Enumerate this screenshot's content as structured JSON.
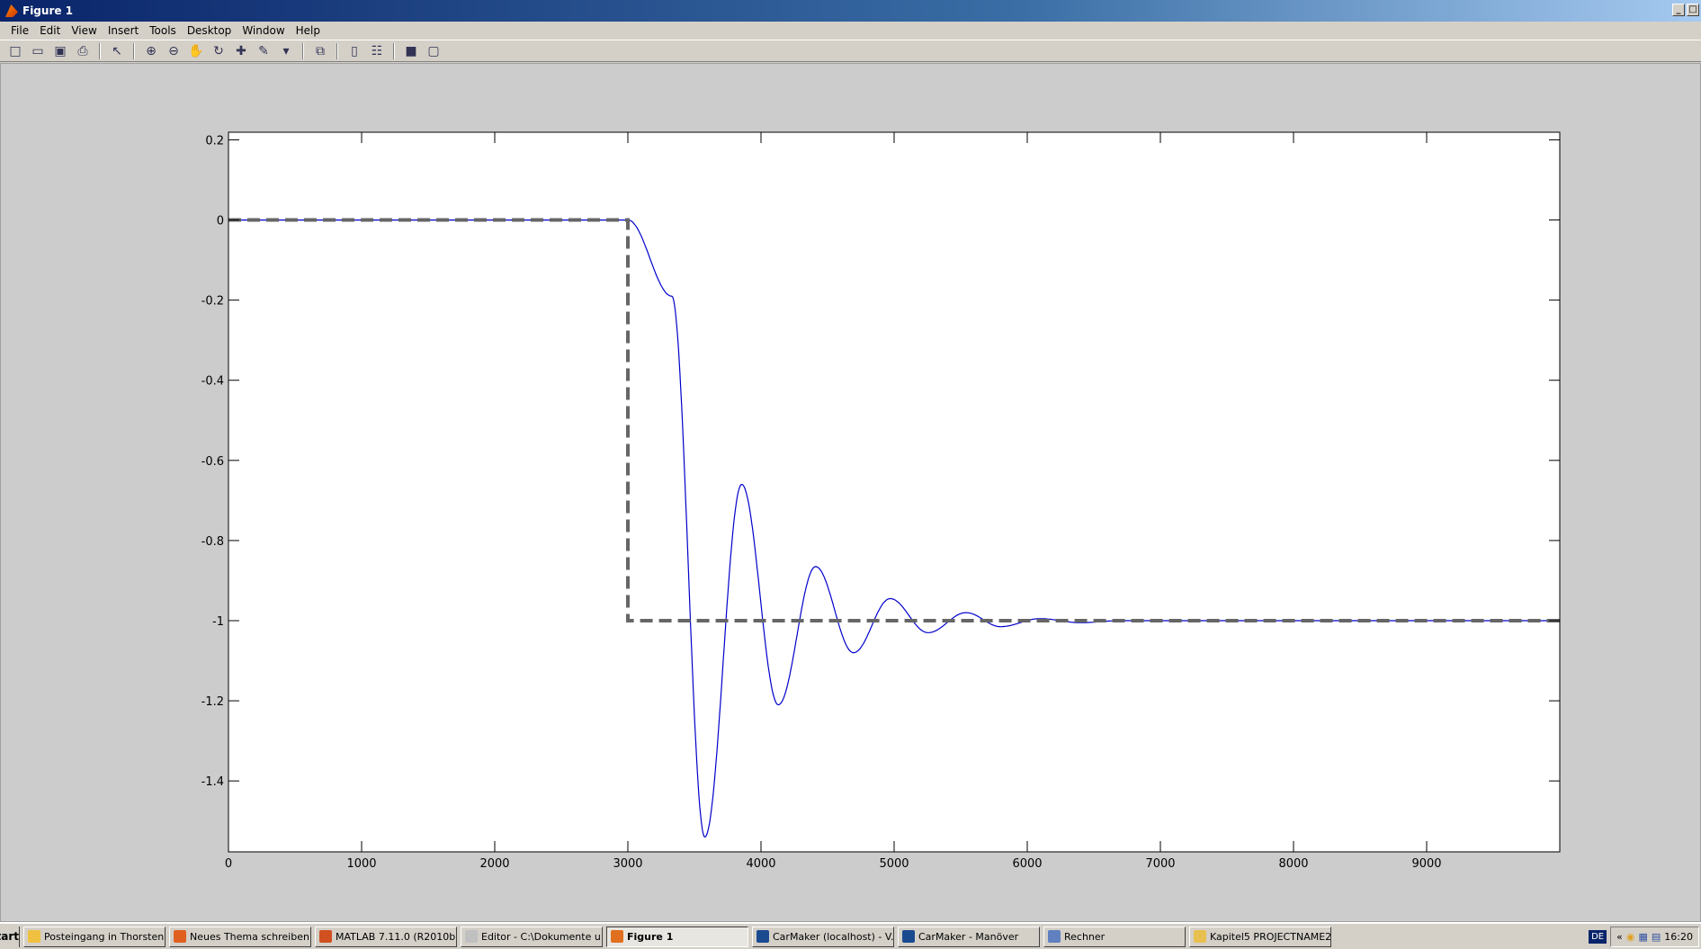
{
  "window": {
    "title": "Figure 1"
  },
  "menu": [
    "File",
    "Edit",
    "View",
    "Insert",
    "Tools",
    "Desktop",
    "Window",
    "Help"
  ],
  "toolbar": [
    {
      "icon": "new-figure-icon",
      "glyph": "□"
    },
    {
      "icon": "open-file-icon",
      "glyph": "▭"
    },
    {
      "icon": "save-icon",
      "glyph": "▣"
    },
    {
      "icon": "print-icon",
      "glyph": "⎙"
    },
    {
      "sep": true
    },
    {
      "icon": "edit-plot-arrow-icon",
      "glyph": "↖"
    },
    {
      "sep": true
    },
    {
      "icon": "zoom-in-icon",
      "glyph": "⊕"
    },
    {
      "icon": "zoom-out-icon",
      "glyph": "⊖"
    },
    {
      "icon": "pan-hand-icon",
      "glyph": "✋"
    },
    {
      "icon": "rotate-3d-icon",
      "glyph": "↻"
    },
    {
      "icon": "data-cursor-icon",
      "glyph": "✚"
    },
    {
      "icon": "brush-icon",
      "glyph": "✎"
    },
    {
      "icon": "dropdown-arrow-icon",
      "glyph": "▾"
    },
    {
      "sep": true
    },
    {
      "icon": "link-plot-icon",
      "glyph": "⧉"
    },
    {
      "sep": true
    },
    {
      "icon": "colorbar-icon",
      "glyph": "▯"
    },
    {
      "icon": "legend-icon",
      "glyph": "☷"
    },
    {
      "sep": true
    },
    {
      "icon": "hide-plot-tools-icon",
      "glyph": "■"
    },
    {
      "icon": "show-plot-tools-icon",
      "glyph": "▢"
    }
  ],
  "chart_data": {
    "type": "line",
    "title": "",
    "xlabel": "",
    "ylabel": "",
    "xlim": [
      0,
      10000
    ],
    "ylim": [
      -1.577,
      0.219
    ],
    "xticks": [
      0,
      1000,
      2000,
      3000,
      4000,
      5000,
      6000,
      7000,
      8000,
      9000
    ],
    "yticks": [
      0.2,
      0,
      -0.2,
      -0.4,
      -0.6,
      -0.8,
      -1,
      -1.2,
      -1.4
    ],
    "xtick_labels": [
      "0",
      "1000",
      "2000",
      "3000",
      "4000",
      "5000",
      "6000",
      "7000",
      "8000",
      "9000"
    ],
    "ytick_labels": [
      "0.2",
      "0",
      "-0.2",
      "-0.4",
      "-0.6",
      "-0.8",
      "-1",
      "-1.2",
      "-1.4"
    ],
    "grid": false,
    "series": [
      {
        "style": "solid",
        "color": "#0000cc",
        "x": [
          0,
          3000,
          3330,
          3578,
          3855,
          4130,
          4410,
          4695,
          4970,
          5255,
          5540,
          5800,
          6095,
          6400,
          6700,
          10000
        ],
        "y": [
          0,
          0,
          -0.19,
          -1.54,
          -0.66,
          -1.21,
          -0.865,
          -1.08,
          -0.945,
          -1.03,
          -0.98,
          -1.015,
          -0.995,
          -1.005,
          -1,
          -1
        ]
      },
      {
        "style": "dashed",
        "color": "#666666",
        "x": [
          0,
          3000,
          3000,
          10000
        ],
        "y": [
          0,
          0,
          -1,
          -1
        ]
      }
    ]
  },
  "taskbar": {
    "start": "start",
    "tasks": [
      {
        "label": "Posteingang in Thorsten...",
        "color": "#f0c040",
        "active": false
      },
      {
        "label": "Neues Thema schreiben ...",
        "color": "#e06020",
        "active": false
      },
      {
        "label": "MATLAB  7.11.0 (R2010b)",
        "color": "#d05020",
        "active": false
      },
      {
        "label": "Editor - C:\\Dokumente u...",
        "color": "#c0c0c0",
        "active": false
      },
      {
        "label": "Figure 1",
        "color": "#e07020",
        "active": true
      },
      {
        "label": "CarMaker (localhost) - V...",
        "color": "#1a4a90",
        "active": false
      },
      {
        "label": "CarMaker - Manöver",
        "color": "#1a4a90",
        "active": false
      },
      {
        "label": "Rechner",
        "color": "#6080c0",
        "active": false
      },
      {
        "label": "Kapitel5 PROJECTNAME2...",
        "color": "#e8c050",
        "active": false
      }
    ],
    "language": "DE",
    "clock": "16:20"
  }
}
